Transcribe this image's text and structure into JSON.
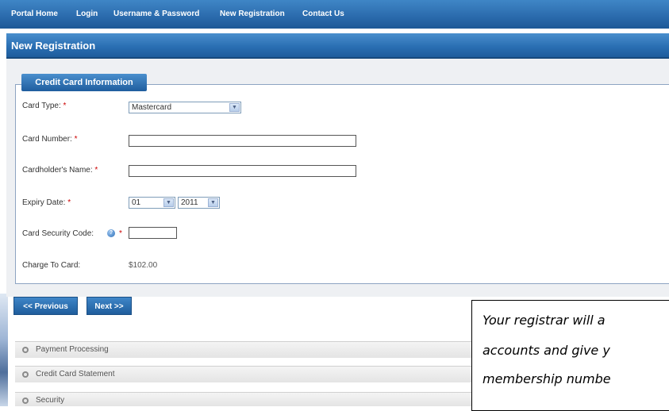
{
  "nav": {
    "items": [
      "Portal Home",
      "Login",
      "Username & Password",
      "New Registration",
      "Contact Us"
    ]
  },
  "page": {
    "title": "New Registration"
  },
  "form": {
    "section_title": "Credit Card Information",
    "required_marker": "*",
    "card_type": {
      "label": "Card Type:",
      "value": "Mastercard"
    },
    "card_number": {
      "label": "Card Number:",
      "value": ""
    },
    "cardholder_name": {
      "label": "Cardholder's Name:",
      "value": ""
    },
    "expiry": {
      "label": "Expiry Date:",
      "month": "01",
      "year": "2011"
    },
    "security_code": {
      "label": "Card Security Code:",
      "help_icon": "?",
      "value": ""
    },
    "charge": {
      "label": "Charge To Card:",
      "value": "$102.00"
    }
  },
  "buttons": {
    "previous": "<< Previous",
    "next": "Next >>"
  },
  "accordion": [
    "Payment Processing",
    "Credit Card Statement",
    "Security"
  ],
  "note": {
    "lines": [
      "Your registrar will a",
      "accounts and give y",
      "membership numbe"
    ]
  }
}
